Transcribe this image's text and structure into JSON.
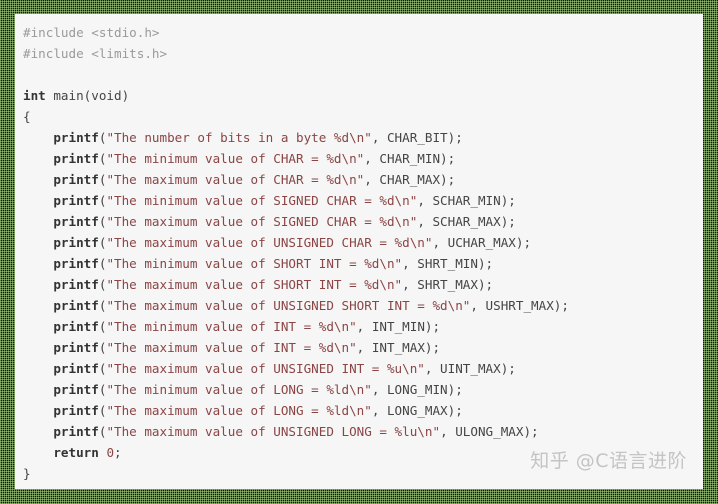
{
  "colors": {
    "background_panel": "#f6f6f6",
    "preprocessor": "#9a9a9a",
    "keyword": "#333333",
    "string": "#8b4545",
    "plain": "#454545",
    "border_dot": "#aadc78",
    "border_dark": "#0c1a08",
    "watermark": "#c4c4c4"
  },
  "code": {
    "language": "c",
    "lines": [
      [
        {
          "t": "pre",
          "v": "#include <stdio.h>"
        }
      ],
      [
        {
          "t": "pre",
          "v": "#include <limits.h>"
        }
      ],
      [],
      [
        {
          "t": "kw",
          "v": "int"
        },
        {
          "t": "plain",
          "v": " main(void)"
        }
      ],
      [
        {
          "t": "plain",
          "v": "{"
        }
      ],
      [
        {
          "t": "plain",
          "v": "    "
        },
        {
          "t": "fn",
          "v": "printf"
        },
        {
          "t": "plain",
          "v": "("
        },
        {
          "t": "str",
          "v": "\"The number of bits in a byte %d\\n\""
        },
        {
          "t": "plain",
          "v": ", CHAR_BIT);"
        }
      ],
      [
        {
          "t": "plain",
          "v": "    "
        },
        {
          "t": "fn",
          "v": "printf"
        },
        {
          "t": "plain",
          "v": "("
        },
        {
          "t": "str",
          "v": "\"The minimum value of CHAR = %d\\n\""
        },
        {
          "t": "plain",
          "v": ", CHAR_MIN);"
        }
      ],
      [
        {
          "t": "plain",
          "v": "    "
        },
        {
          "t": "fn",
          "v": "printf"
        },
        {
          "t": "plain",
          "v": "("
        },
        {
          "t": "str",
          "v": "\"The maximum value of CHAR = %d\\n\""
        },
        {
          "t": "plain",
          "v": ", CHAR_MAX);"
        }
      ],
      [
        {
          "t": "plain",
          "v": "    "
        },
        {
          "t": "fn",
          "v": "printf"
        },
        {
          "t": "plain",
          "v": "("
        },
        {
          "t": "str",
          "v": "\"The minimum value of SIGNED CHAR = %d\\n\""
        },
        {
          "t": "plain",
          "v": ", SCHAR_MIN);"
        }
      ],
      [
        {
          "t": "plain",
          "v": "    "
        },
        {
          "t": "fn",
          "v": "printf"
        },
        {
          "t": "plain",
          "v": "("
        },
        {
          "t": "str",
          "v": "\"The maximum value of SIGNED CHAR = %d\\n\""
        },
        {
          "t": "plain",
          "v": ", SCHAR_MAX);"
        }
      ],
      [
        {
          "t": "plain",
          "v": "    "
        },
        {
          "t": "fn",
          "v": "printf"
        },
        {
          "t": "plain",
          "v": "("
        },
        {
          "t": "str",
          "v": "\"The maximum value of UNSIGNED CHAR = %d\\n\""
        },
        {
          "t": "plain",
          "v": ", UCHAR_MAX);"
        }
      ],
      [
        {
          "t": "plain",
          "v": "    "
        },
        {
          "t": "fn",
          "v": "printf"
        },
        {
          "t": "plain",
          "v": "("
        },
        {
          "t": "str",
          "v": "\"The minimum value of SHORT INT = %d\\n\""
        },
        {
          "t": "plain",
          "v": ", SHRT_MIN);"
        }
      ],
      [
        {
          "t": "plain",
          "v": "    "
        },
        {
          "t": "fn",
          "v": "printf"
        },
        {
          "t": "plain",
          "v": "("
        },
        {
          "t": "str",
          "v": "\"The maximum value of SHORT INT = %d\\n\""
        },
        {
          "t": "plain",
          "v": ", SHRT_MAX);"
        }
      ],
      [
        {
          "t": "plain",
          "v": "    "
        },
        {
          "t": "fn",
          "v": "printf"
        },
        {
          "t": "plain",
          "v": "("
        },
        {
          "t": "str",
          "v": "\"The maximum value of UNSIGNED SHORT INT = %d\\n\""
        },
        {
          "t": "plain",
          "v": ", USHRT_MAX);"
        }
      ],
      [
        {
          "t": "plain",
          "v": "    "
        },
        {
          "t": "fn",
          "v": "printf"
        },
        {
          "t": "plain",
          "v": "("
        },
        {
          "t": "str",
          "v": "\"The minimum value of INT = %d\\n\""
        },
        {
          "t": "plain",
          "v": ", INT_MIN);"
        }
      ],
      [
        {
          "t": "plain",
          "v": "    "
        },
        {
          "t": "fn",
          "v": "printf"
        },
        {
          "t": "plain",
          "v": "("
        },
        {
          "t": "str",
          "v": "\"The maximum value of INT = %d\\n\""
        },
        {
          "t": "plain",
          "v": ", INT_MAX);"
        }
      ],
      [
        {
          "t": "plain",
          "v": "    "
        },
        {
          "t": "fn",
          "v": "printf"
        },
        {
          "t": "plain",
          "v": "("
        },
        {
          "t": "str",
          "v": "\"The maximum value of UNSIGNED INT = %u\\n\""
        },
        {
          "t": "plain",
          "v": ", UINT_MAX);"
        }
      ],
      [
        {
          "t": "plain",
          "v": "    "
        },
        {
          "t": "fn",
          "v": "printf"
        },
        {
          "t": "plain",
          "v": "("
        },
        {
          "t": "str",
          "v": "\"The minimum value of LONG = %ld\\n\""
        },
        {
          "t": "plain",
          "v": ", LONG_MIN);"
        }
      ],
      [
        {
          "t": "plain",
          "v": "    "
        },
        {
          "t": "fn",
          "v": "printf"
        },
        {
          "t": "plain",
          "v": "("
        },
        {
          "t": "str",
          "v": "\"The maximum value of LONG = %ld\\n\""
        },
        {
          "t": "plain",
          "v": ", LONG_MAX);"
        }
      ],
      [
        {
          "t": "plain",
          "v": "    "
        },
        {
          "t": "fn",
          "v": "printf"
        },
        {
          "t": "plain",
          "v": "("
        },
        {
          "t": "str",
          "v": "\"The maximum value of UNSIGNED LONG = %lu\\n\""
        },
        {
          "t": "plain",
          "v": ", ULONG_MAX);"
        }
      ],
      [
        {
          "t": "plain",
          "v": "    "
        },
        {
          "t": "kw",
          "v": "return"
        },
        {
          "t": "plain",
          "v": " "
        },
        {
          "t": "num",
          "v": "0"
        },
        {
          "t": "plain",
          "v": ";"
        }
      ],
      [
        {
          "t": "plain",
          "v": "}"
        }
      ]
    ]
  },
  "watermark": {
    "text": "知乎 @C语言进阶"
  }
}
